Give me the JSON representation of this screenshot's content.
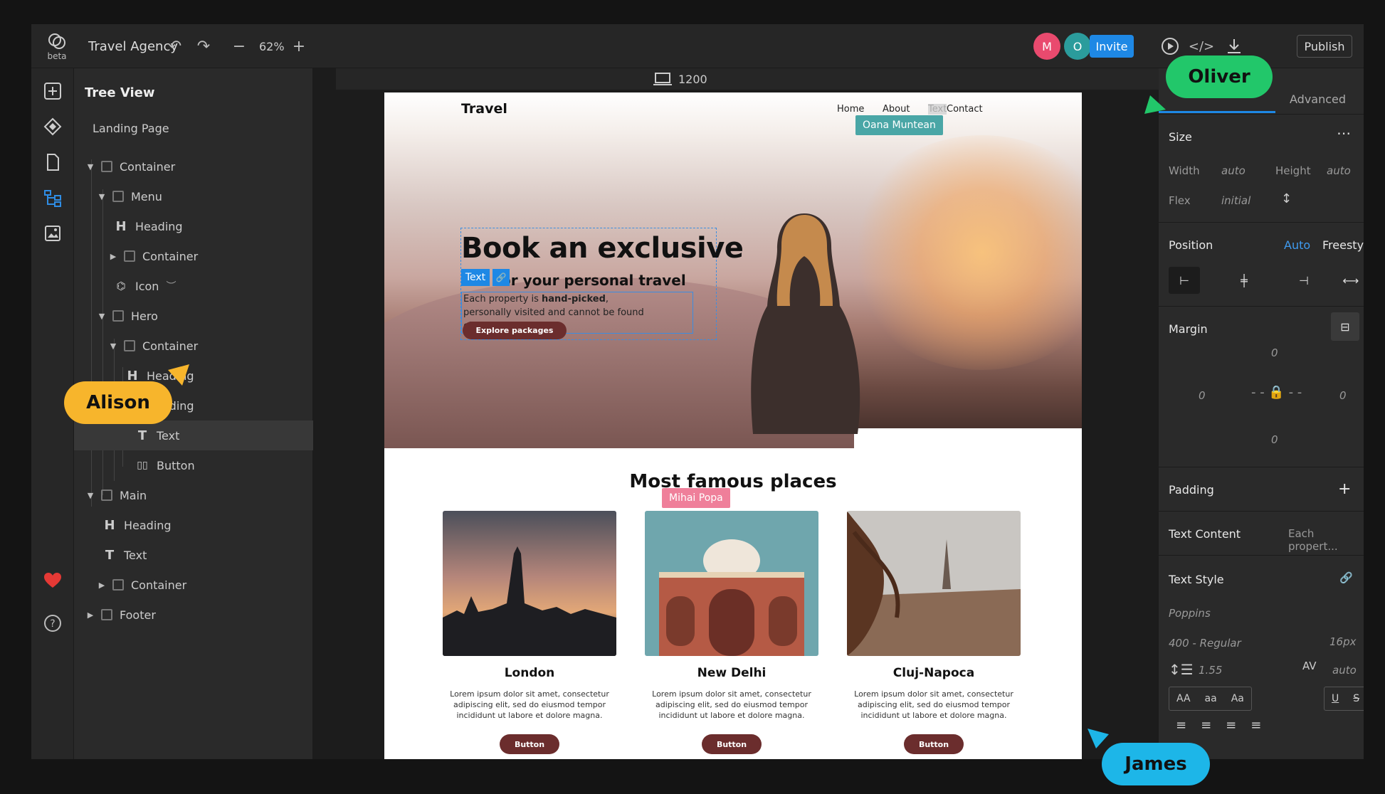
{
  "topbar": {
    "beta_label": "beta",
    "project_name": "Travel Agency",
    "zoom_level": "62%",
    "avatars": [
      {
        "letter": "M",
        "color": "#e94a6e"
      },
      {
        "letter": "O",
        "color": "#2b9c9c"
      }
    ],
    "invite_label": "Invite",
    "publish_label": "Publish"
  },
  "tree": {
    "title": "Tree View",
    "page_name": "Landing Page",
    "nodes": [
      {
        "label": "Container"
      },
      {
        "label": "Menu"
      },
      {
        "label": "Heading"
      },
      {
        "label": "Container"
      },
      {
        "label": "Icon"
      },
      {
        "label": "Hero"
      },
      {
        "label": "Container"
      },
      {
        "label": "Heading"
      },
      {
        "label": "Heading"
      },
      {
        "label": "Text"
      },
      {
        "label": "Button"
      },
      {
        "label": "Main"
      },
      {
        "label": "Heading"
      },
      {
        "label": "Text"
      },
      {
        "label": "Container"
      },
      {
        "label": "Footer"
      }
    ]
  },
  "canvas": {
    "viewport_width": "1200",
    "site": {
      "logo": "Travel",
      "nav": [
        "Home",
        "About",
        "Contact"
      ],
      "nav_overlap": "Text",
      "hero_heading": "Book an exclusive",
      "hero_sub": "or your personal travel",
      "hero_text_prefix": "Each property is ",
      "hero_text_bold": "hand-picked",
      "hero_text_suffix": ",",
      "hero_text_line2": "personally visited and cannot be found elsewhere.",
      "hero_button": "Explore packages",
      "section_title": "Most famous places",
      "cards": [
        {
          "title": "London",
          "text": "Lorem ipsum dolor sit amet, consectetur adipiscing elit, sed do eiusmod tempor incididunt ut labore et dolore magna.",
          "button": "Button"
        },
        {
          "title": "New Delhi",
          "text": "Lorem ipsum dolor sit amet, consectetur adipiscing elit, sed do eiusmod tempor incididunt ut labore et dolore magna.",
          "button": "Button"
        },
        {
          "title": "Cluj-Napoca",
          "text": "Lorem ipsum dolor sit amet, consectetur adipiscing elit, sed do eiusmod tempor incididunt ut labore et dolore magna.",
          "button": "Button"
        }
      ]
    },
    "selection_tag": "Text",
    "collaborators": [
      {
        "name": "Oana Muntean",
        "color": "#4aa6a6"
      },
      {
        "name": "Mihai Popa",
        "color": "#ef7f9a"
      }
    ]
  },
  "props": {
    "tab_advanced": "Advanced",
    "size": {
      "title": "Size",
      "width_label": "Width",
      "width_value": "auto",
      "height_label": "Height",
      "height_value": "auto",
      "flex_label": "Flex",
      "flex_value": "initial"
    },
    "position": {
      "title": "Position",
      "auto": "Auto",
      "freestyle": "Freestyle"
    },
    "margin": {
      "title": "Margin",
      "top": "0",
      "left": "0",
      "right": "0",
      "bottom": "0"
    },
    "padding": {
      "title": "Padding"
    },
    "text_content": {
      "title": "Text Content",
      "value": "Each propert..."
    },
    "text_style": {
      "title": "Text Style",
      "font": "Poppins",
      "weight": "400 - Regular",
      "size": "16px",
      "line_height": "1.55",
      "letter_spacing": "auto",
      "case_options": [
        "AA",
        "aa",
        "Aa"
      ]
    }
  },
  "cursors": [
    {
      "name": "Oliver",
      "color": "#22c76a"
    },
    {
      "name": "Alison",
      "color": "#f7b52c"
    },
    {
      "name": "James",
      "color": "#1db6e8"
    }
  ]
}
